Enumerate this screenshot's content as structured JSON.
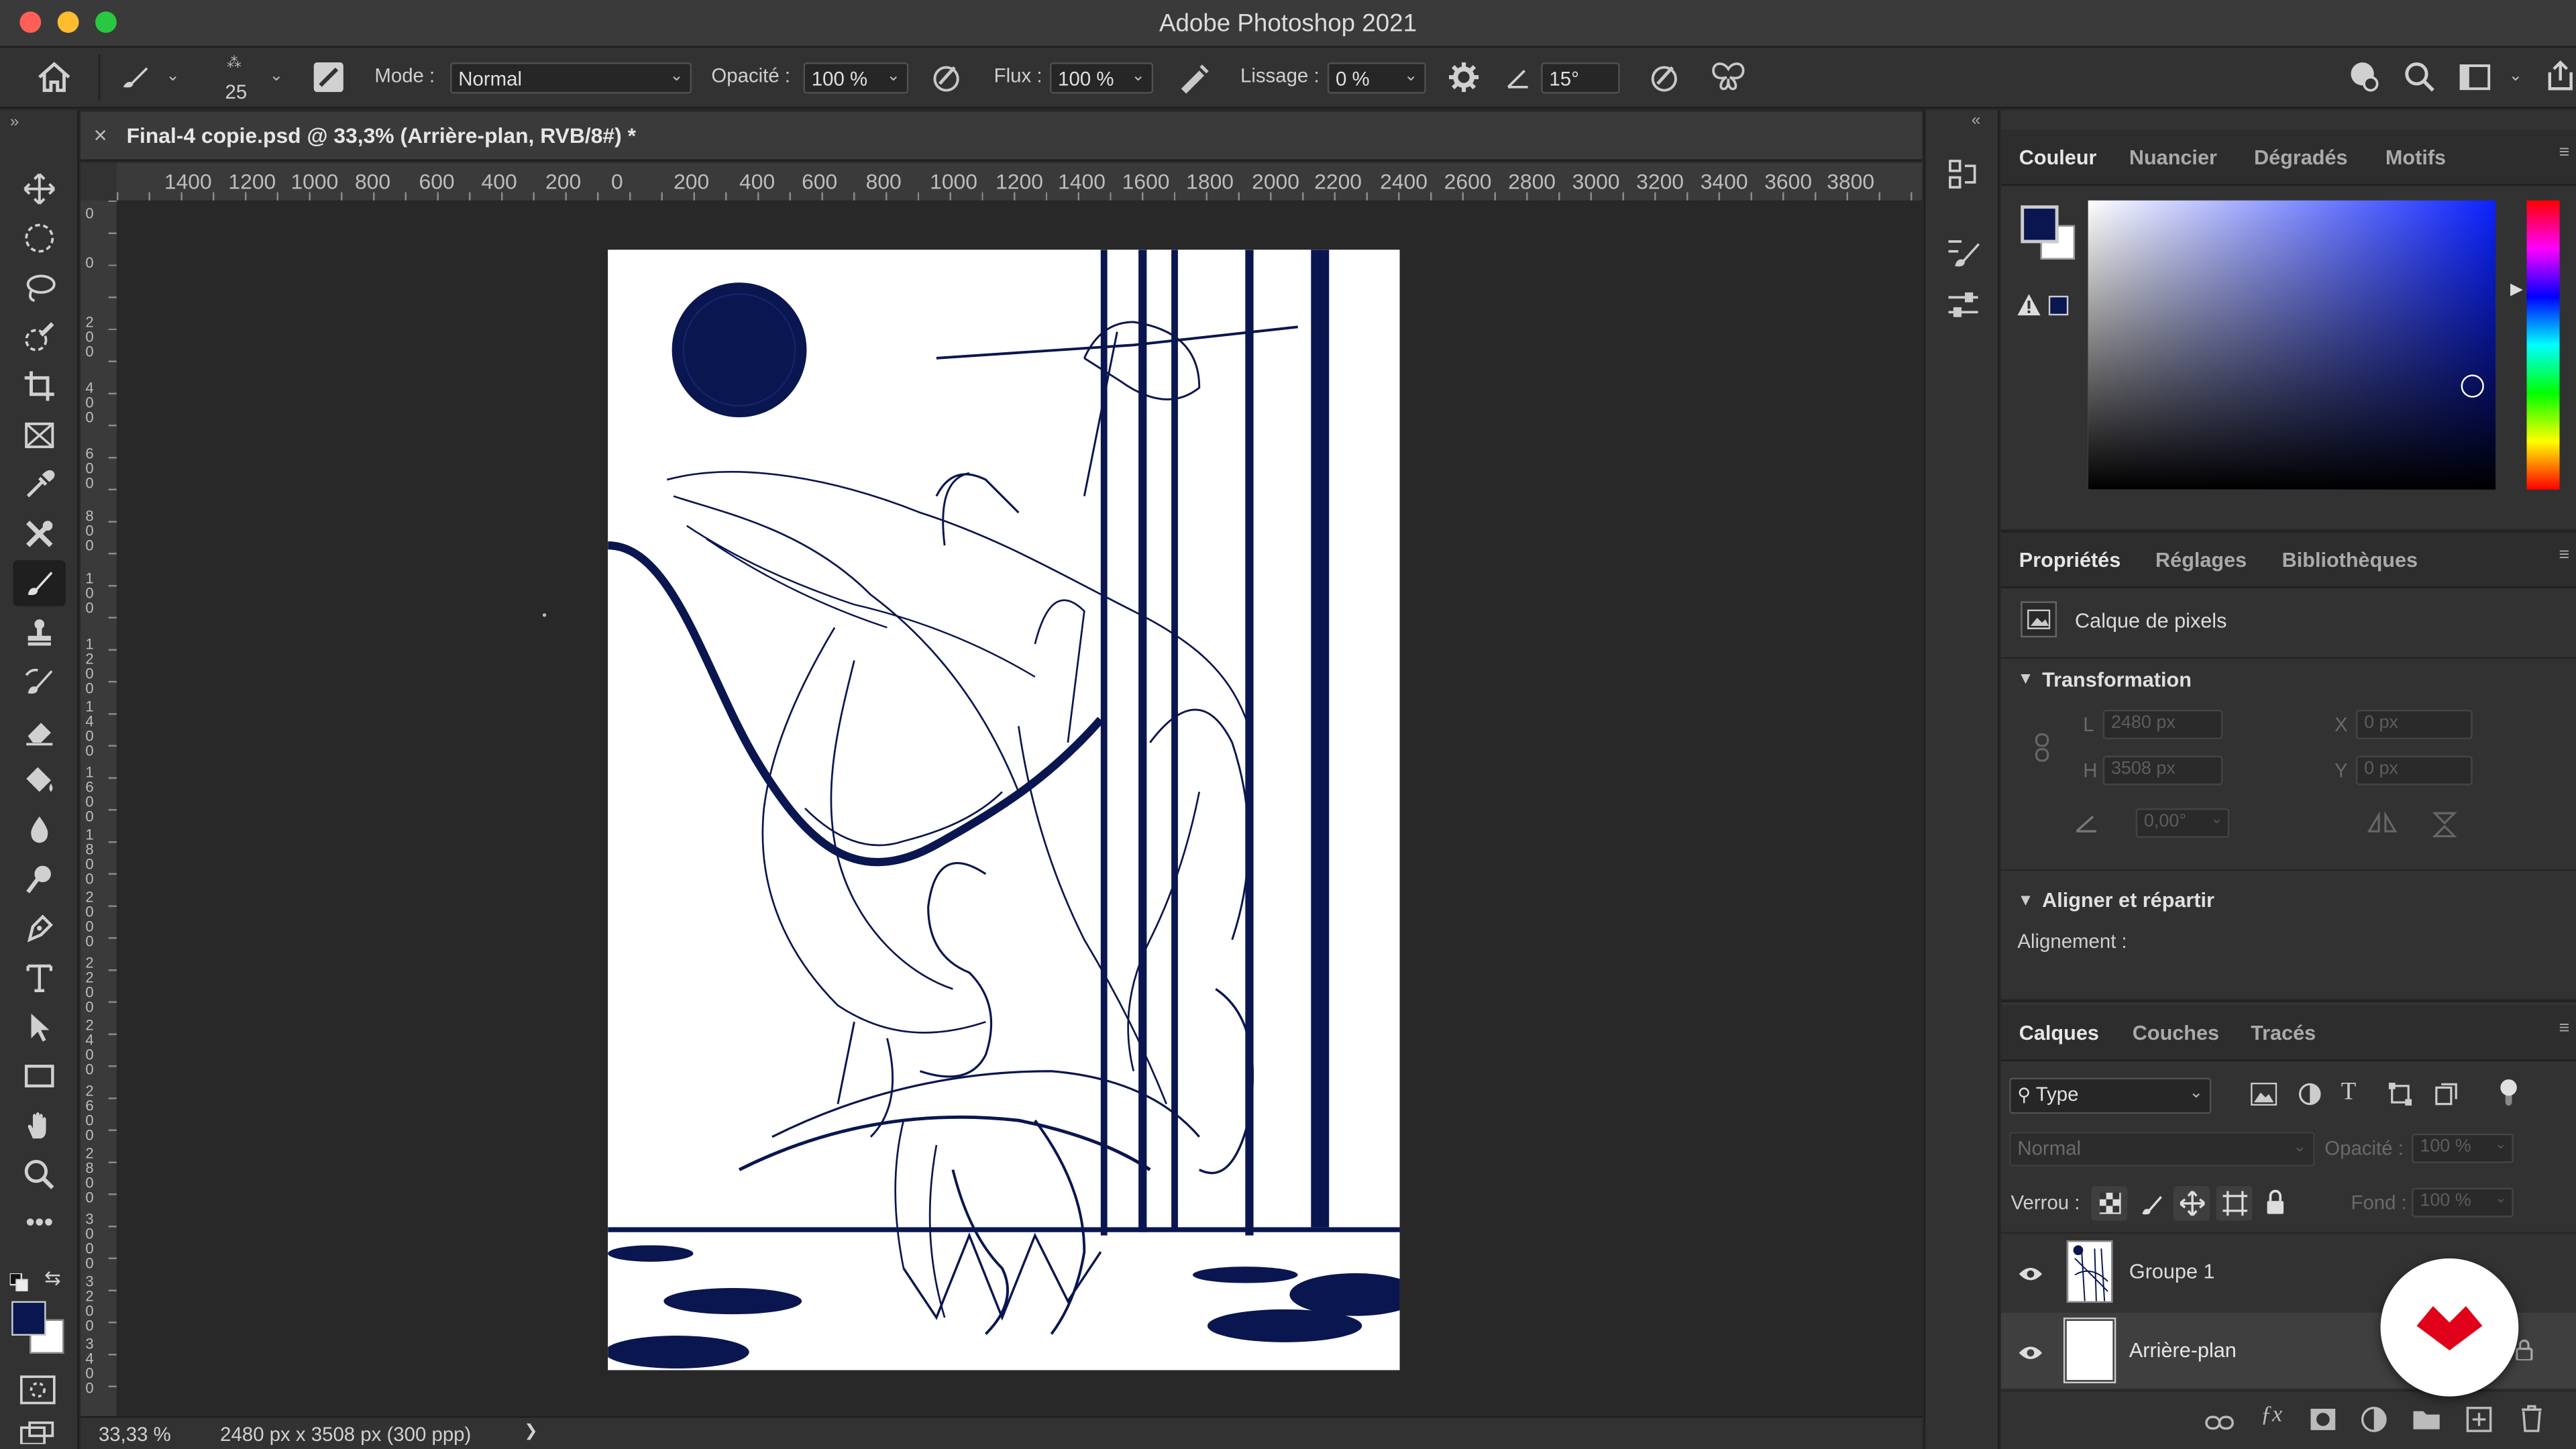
{
  "window": {
    "title": "Adobe Photoshop 2021"
  },
  "options_bar": {
    "brush_size": "25",
    "mode_label": "Mode :",
    "mode_value": "Normal",
    "opacity_label": "Opacité :",
    "opacity_value": "100 %",
    "flow_label": "Flux :",
    "flow_value": "100 %",
    "smoothing_label": "Lissage :",
    "smoothing_value": "0 %",
    "angle_value": "15°"
  },
  "document": {
    "tab_title": "Final-4 copie.psd @ 33,3% (Arrière-plan, RVB/8#) *",
    "close_glyph": "×"
  },
  "ruler": {
    "top_ticks": [
      "1400",
      "1200",
      "1000",
      "800",
      "600",
      "400",
      "200",
      "0",
      "200",
      "400",
      "600",
      "800",
      "1000",
      "1200",
      "1400",
      "1600",
      "1800",
      "2000",
      "2200",
      "2400",
      "2600",
      "2800",
      "3000",
      "3200",
      "3400",
      "3600",
      "3800"
    ],
    "left_ticks": [
      "0",
      "0",
      "2 0 0",
      "4 0 0",
      "6 0 0",
      "8 0 0",
      "1 0 0",
      "1 2 0 0",
      "1 4 0 0",
      "1 6 0 0",
      "1 8 0 0",
      "2 0 0 0",
      "2 2 0 0",
      "2 4 0 0",
      "2 6 0 0",
      "2 8 0 0",
      "3 0 0 0",
      "3 2 0 0",
      "3 4 0 0"
    ]
  },
  "status": {
    "zoom": "33,33 %",
    "doc_info": "2480 px x 3508 px (300 ppp)",
    "arrow": "❯"
  },
  "colors": {
    "foreground": "#0a1650",
    "background": "#ffffff",
    "accent": "#0a1650",
    "brand": "#e0001a"
  },
  "color_panel": {
    "tabs": [
      "Couleur",
      "Nuancier",
      "Dégradés",
      "Motifs"
    ]
  },
  "properties_panel": {
    "tabs": [
      "Propriétés",
      "Réglages",
      "Bibliothèques"
    ],
    "layer_kind": "Calque de pixels",
    "transform_title": "Transformation",
    "w_label": "L",
    "w_value": "2480 px",
    "h_label": "H",
    "h_value": "3508 px",
    "x_label": "X",
    "x_value": "0 px",
    "y_label": "Y",
    "y_value": "0 px",
    "angle_value": "0,00°",
    "align_title": "Aligner et répartir",
    "alignment_label": "Alignement :"
  },
  "layers_panel": {
    "tabs": [
      "Calques",
      "Couches",
      "Tracés"
    ],
    "filter_value": "Type",
    "blend_mode": "Normal",
    "opacity_label": "Opacité :",
    "opacity_value": "100 %",
    "lock_label": "Verrou :",
    "fill_label": "Fond :",
    "fill_value": "100 %",
    "layers": [
      {
        "name": "Groupe 1"
      },
      {
        "name": "Arrière-plan"
      }
    ]
  }
}
